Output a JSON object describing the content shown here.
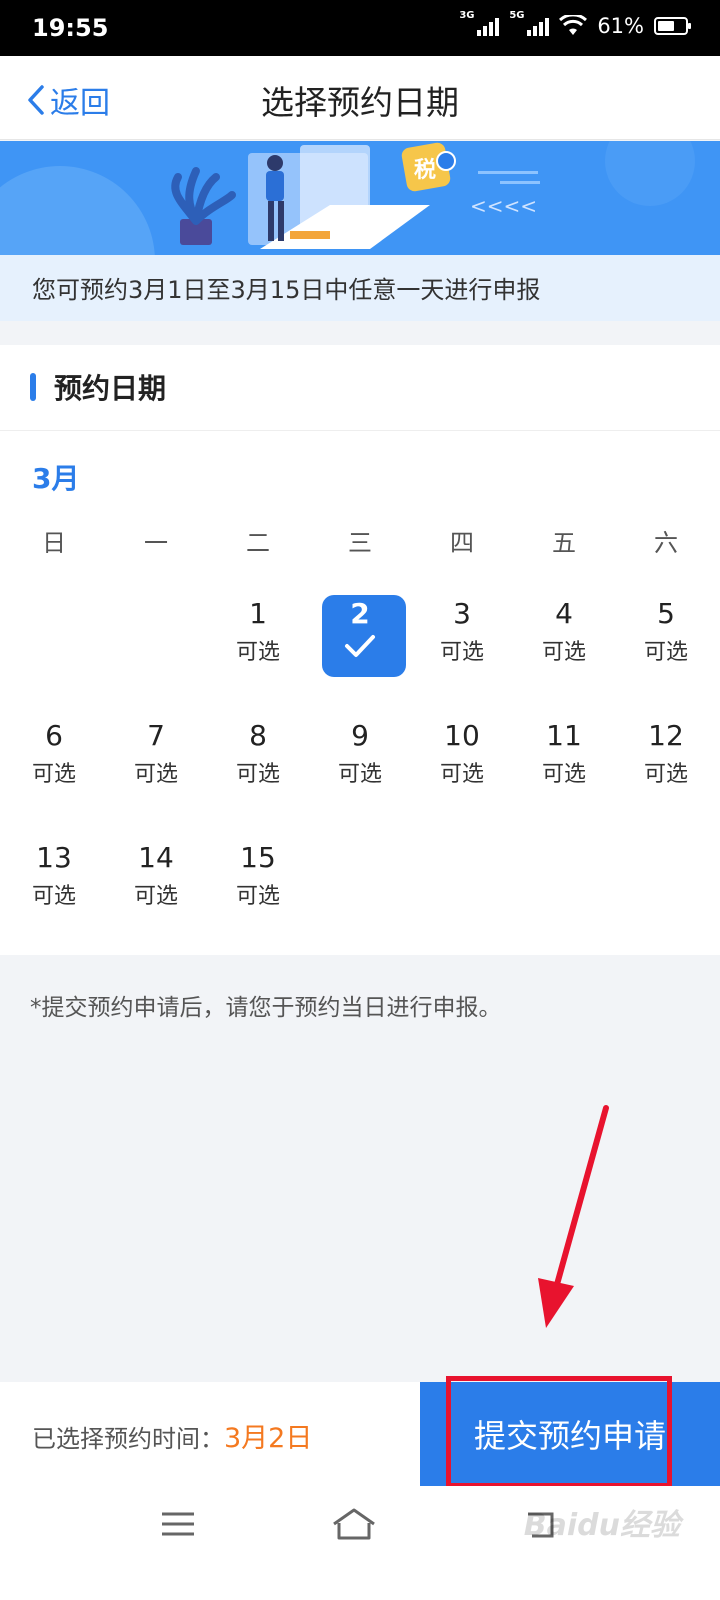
{
  "status_bar": {
    "time": "19:55",
    "network1": "3G",
    "network2": "5G",
    "battery": "61%",
    "battery_level": 0.61
  },
  "nav": {
    "back_label": "返回",
    "title": "选择预约日期"
  },
  "banner": {
    "tax_label": "税",
    "arrows": "<<<<"
  },
  "notice": "您可预约3月1日至3月15日中任意一天进行申报",
  "section": {
    "title": "预约日期",
    "month": "3月"
  },
  "weekdays": [
    "日",
    "一",
    "二",
    "三",
    "四",
    "五",
    "六"
  ],
  "days": [
    {
      "day": "1",
      "status": "可选"
    },
    {
      "day": "2",
      "status": "",
      "selected": true
    },
    {
      "day": "3",
      "status": "可选"
    },
    {
      "day": "4",
      "status": "可选"
    },
    {
      "day": "5",
      "status": "可选"
    },
    {
      "day": "6",
      "status": "可选"
    },
    {
      "day": "7",
      "status": "可选"
    },
    {
      "day": "8",
      "status": "可选"
    },
    {
      "day": "9",
      "status": "可选"
    },
    {
      "day": "10",
      "status": "可选"
    },
    {
      "day": "11",
      "status": "可选"
    },
    {
      "day": "12",
      "status": "可选"
    },
    {
      "day": "13",
      "status": "可选"
    },
    {
      "day": "14",
      "status": "可选"
    },
    {
      "day": "15",
      "status": "可选"
    }
  ],
  "footnote": "*提交预约申请后，请您于预约当日进行申报。",
  "bottom": {
    "selected_label": "已选择预约时间：",
    "selected_value": "3月2日",
    "submit_label": "提交预约申请"
  },
  "watermark": "Baidu经验",
  "colors": {
    "accent": "#2b7de9",
    "highlight": "#e8132e",
    "selected_value": "#f47920"
  }
}
